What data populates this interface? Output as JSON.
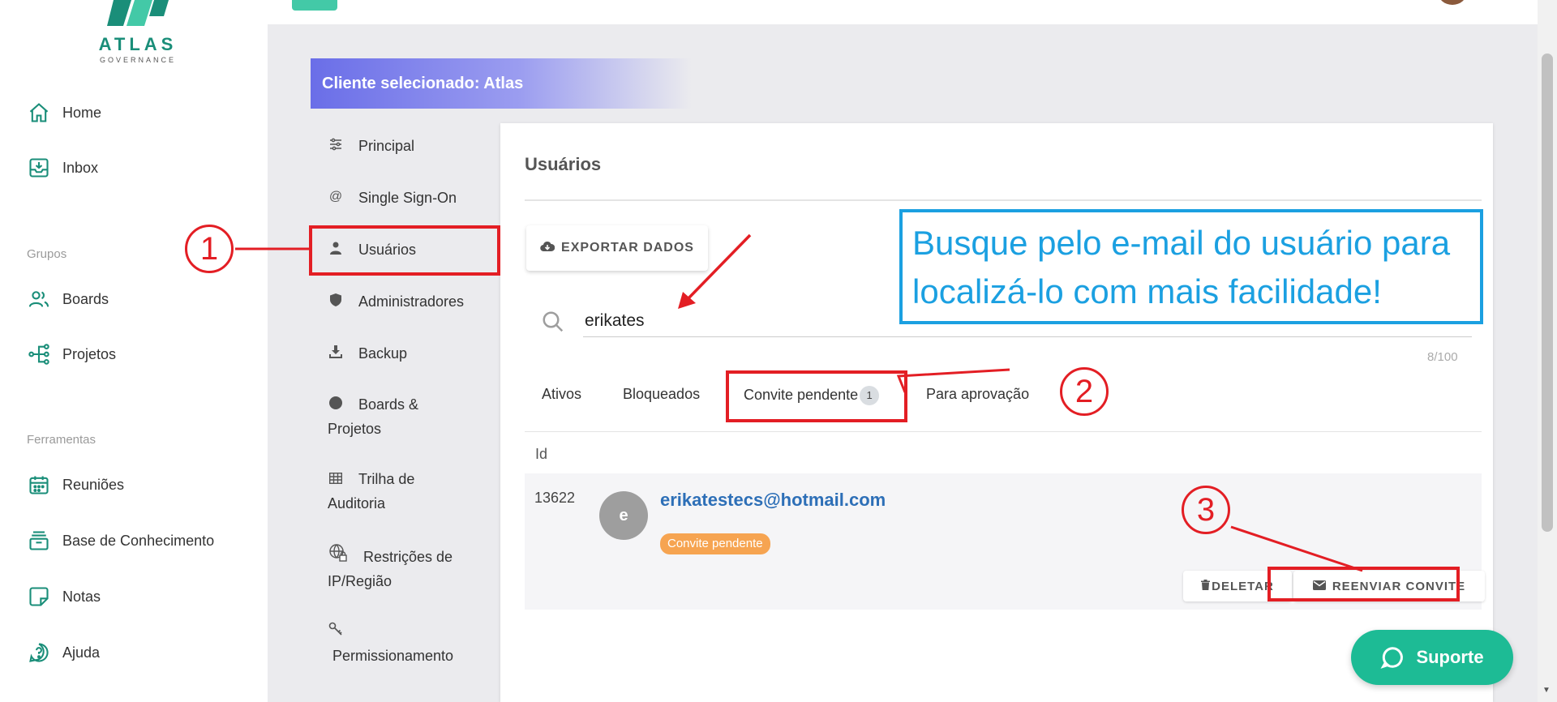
{
  "logo": {
    "name": "ATLAS",
    "sub": "GOVERNANCE"
  },
  "sidebar": {
    "items": [
      {
        "label": "Home",
        "icon": "home-icon"
      },
      {
        "label": "Inbox",
        "icon": "inbox-icon"
      }
    ],
    "groups_title": "Grupos",
    "groups": [
      {
        "label": "Boards",
        "icon": "users-icon"
      },
      {
        "label": "Projetos",
        "icon": "network-icon"
      }
    ],
    "tools_title": "Ferramentas",
    "tools": [
      {
        "label": "Reuniões",
        "icon": "calendar-icon"
      },
      {
        "label": "Base de Conhecimento",
        "icon": "archive-icon"
      },
      {
        "label": "Notas",
        "icon": "note-icon"
      },
      {
        "label": "Ajuda",
        "icon": "help-icon"
      }
    ]
  },
  "banner": {
    "text": "Cliente selecionado: Atlas"
  },
  "settings_menu": {
    "items": [
      {
        "label": "Principal",
        "icon": "sliders-icon"
      },
      {
        "label": "Single Sign-On",
        "icon": "at-icon"
      },
      {
        "label": "Usuários",
        "icon": "user-icon"
      },
      {
        "label": "Administradores",
        "icon": "shield-icon"
      },
      {
        "label": "Backup",
        "icon": "download-icon"
      },
      {
        "label_line1": "Boards &",
        "label_line2": "Projetos",
        "icon": "circle-icon"
      },
      {
        "label_line1": "Trilha de",
        "label_line2": "Auditoria",
        "icon": "table-icon"
      },
      {
        "label_line1": "Restrições de",
        "label_line2": "IP/Região",
        "icon": "globe-lock-icon"
      },
      {
        "label_line2": "Permissionamento",
        "icon": "key-icon"
      }
    ]
  },
  "card": {
    "title": "Usuários",
    "export_label": "EXPORTAR DADOS",
    "search": {
      "value": "erikates",
      "count": "8/100"
    },
    "tabs": [
      {
        "label": "Ativos"
      },
      {
        "label": "Bloqueados"
      },
      {
        "label": "Convite pendente",
        "badge": "1"
      },
      {
        "label": "Para aprovação"
      }
    ],
    "column_header": "Id",
    "rows": [
      {
        "id": "13622",
        "avatar_letter": "e",
        "email": "erikatestecs@hotmail.com",
        "status": "Convite pendente",
        "delete_label": "DELETAR",
        "resend_label": "REENVIAR CONVITE"
      }
    ]
  },
  "annotations": {
    "step1": "1",
    "step2": "2",
    "step3": "3",
    "callout_line1": "Busque pelo e-mail do usuário para",
    "callout_line2": "localizá-lo com mais facilidade!",
    "color_red": "#e31e24",
    "color_blue": "#1ba0e1"
  },
  "support": {
    "label": "Suporte"
  },
  "colors": {
    "brand": "#1a8e79",
    "accent": "#1dbb95",
    "banner": "#6a6ee8",
    "badge": "#f6a451"
  }
}
